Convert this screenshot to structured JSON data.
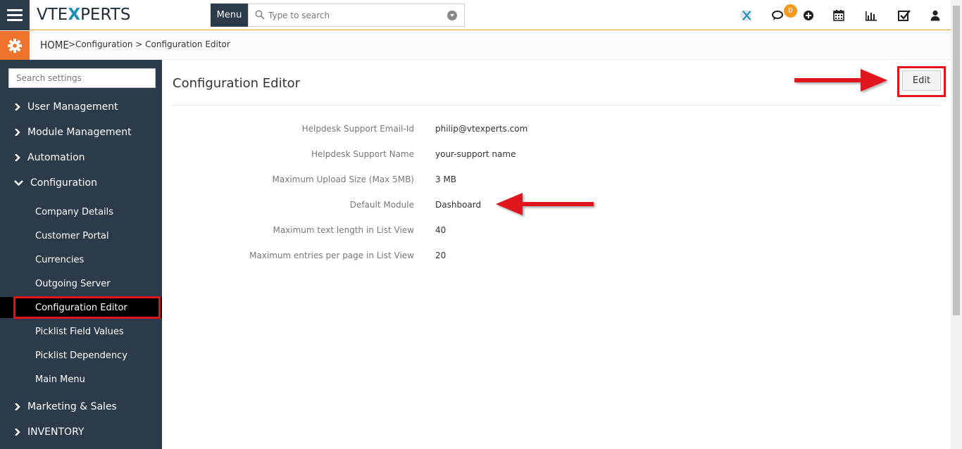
{
  "header": {
    "logo_prefix": "VTE",
    "logo_x": "X",
    "logo_suffix": "PERTS",
    "menu_label": "Menu",
    "search_placeholder": "Type to search",
    "notification_count": "0"
  },
  "breadcrumb": {
    "home": "HOME",
    "path": ">Configuration > Configuration Editor"
  },
  "sidebar": {
    "search_placeholder": "Search settings",
    "groups": [
      {
        "label": "User Management"
      },
      {
        "label": "Module Management"
      },
      {
        "label": "Automation"
      },
      {
        "label": "Configuration"
      },
      {
        "label": "Marketing & Sales"
      },
      {
        "label": "INVENTORY"
      }
    ],
    "config_items": [
      {
        "label": "Company Details"
      },
      {
        "label": "Customer Portal"
      },
      {
        "label": "Currencies"
      },
      {
        "label": "Outgoing Server"
      },
      {
        "label": "Configuration Editor"
      },
      {
        "label": "Picklist Field Values"
      },
      {
        "label": "Picklist Dependency"
      },
      {
        "label": "Main Menu"
      }
    ]
  },
  "main": {
    "title": "Configuration Editor",
    "edit_label": "Edit",
    "fields": [
      {
        "label": "Helpdesk Support Email-Id",
        "value": "philip@vtexperts.com"
      },
      {
        "label": "Helpdesk Support Name",
        "value": "your-support name"
      },
      {
        "label": "Maximum Upload Size (Max 5MB)",
        "value": "3 MB"
      },
      {
        "label": "Default Module",
        "value": "Dashboard"
      },
      {
        "label": "Maximum text length in List View",
        "value": "40"
      },
      {
        "label": "Maximum entries per page in List View",
        "value": "20"
      }
    ]
  },
  "colors": {
    "sidebar_bg": "#2c3b49",
    "accent_orange": "#f0732b",
    "highlight_red": "#e0141a",
    "badge_orange": "#f39a1e"
  }
}
